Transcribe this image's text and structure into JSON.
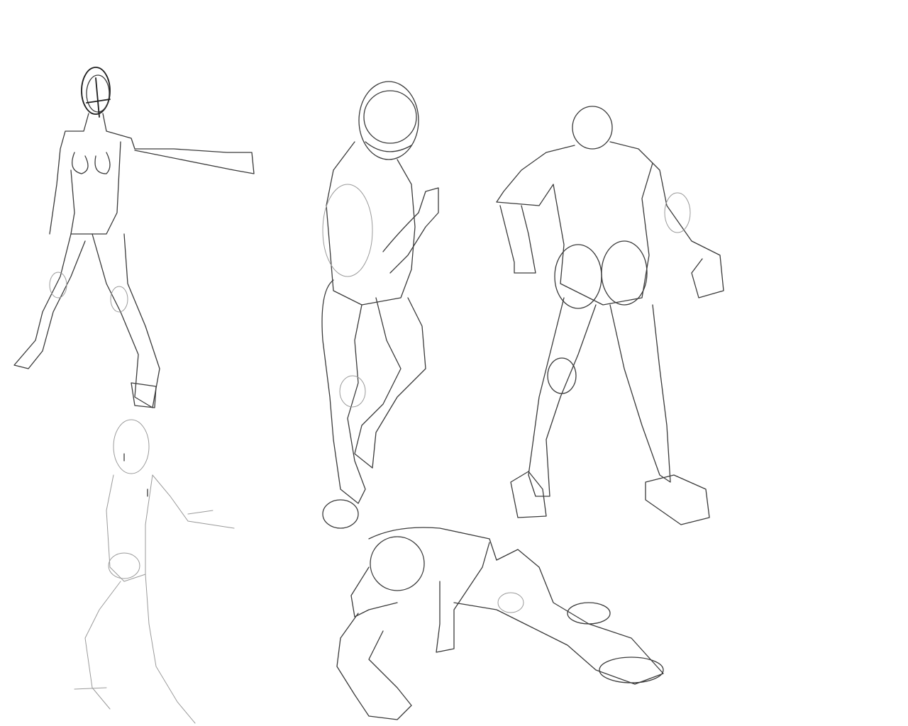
{
  "canvas": {
    "background": "#ffffff",
    "stroke_color": "#3a3a3a"
  }
}
